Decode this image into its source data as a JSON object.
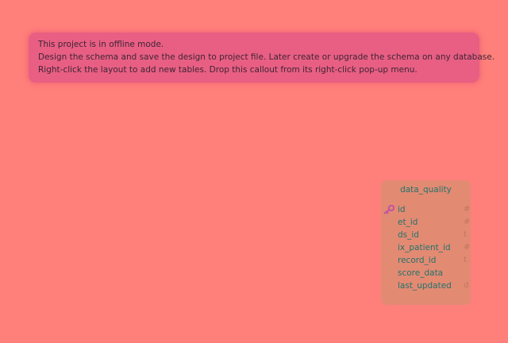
{
  "callout": {
    "lines": [
      "This project is in offline mode.",
      "Design the schema and save the design to project file. Later create or upgrade the schema on any database.",
      "Right-click the layout to add new tables. Drop this callout from its right-click pop-up menu."
    ]
  },
  "table": {
    "name": "data_quality",
    "columns": [
      {
        "name": "id",
        "type": "#",
        "primary_key": true,
        "icon": "key-icon"
      },
      {
        "name": "et_id",
        "type": "#"
      },
      {
        "name": "ds_id",
        "type": "t"
      },
      {
        "name": "ix_patient_id",
        "type": "#"
      },
      {
        "name": "record_id",
        "type": "t"
      },
      {
        "name": "score_data",
        "type": ""
      },
      {
        "name": "last_updated",
        "type": "d"
      }
    ]
  },
  "colors": {
    "background": "#ff7f7b",
    "callout": "#e85f83",
    "table_card": "#e38a73",
    "text_teal": "#20746b",
    "key_icon": "#c0559e"
  }
}
